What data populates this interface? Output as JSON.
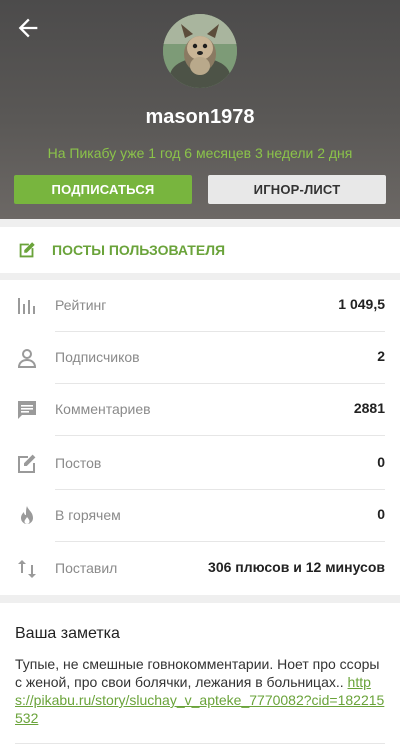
{
  "header": {
    "username": "mason1978",
    "member_since": "На Пикабу уже 1 год 6 месяцев 3 недели 2 дня",
    "subscribe_label": "ПОДПИСАТЬСЯ",
    "ignore_label": "ИГНОР-ЛИСТ",
    "back_icon": "arrow-left-icon",
    "avatar_icon": "avatar-dog-photo"
  },
  "posts_bar": {
    "label": "ПОСТЫ ПОЛЬЗОВАТЕЛЯ",
    "icon": "edit-note-icon"
  },
  "stats": {
    "rating": {
      "label": "Рейтинг",
      "value": "1 049,5",
      "icon": "bar-chart-icon"
    },
    "subscribers": {
      "label": "Подписчиков",
      "value": "2",
      "icon": "person-icon"
    },
    "comments": {
      "label": "Комментариев",
      "value": "2881",
      "icon": "comment-icon"
    },
    "posts": {
      "label": "Постов",
      "value": "0",
      "icon": "edit-note-icon"
    },
    "hot": {
      "label": "В горячем",
      "value": "0",
      "icon": "flame-icon"
    },
    "votes": {
      "label": "Поставил",
      "value": "306 плюсов и 12 минусов",
      "icon": "up-down-arrows-icon"
    }
  },
  "note": {
    "title": "Ваша заметка",
    "text": "Тупые, не смешные говнокомментарии. Ноет про ссоры с женой, про свои болячки, лежания в больницах.. ",
    "link": "https://pikabu.ru/story/sluchay_v_apteke_7770082?cid=182215532"
  },
  "colors": {
    "accent_green": "#78b53e",
    "link_green": "#6aa33a",
    "header_bg": "#545250"
  }
}
